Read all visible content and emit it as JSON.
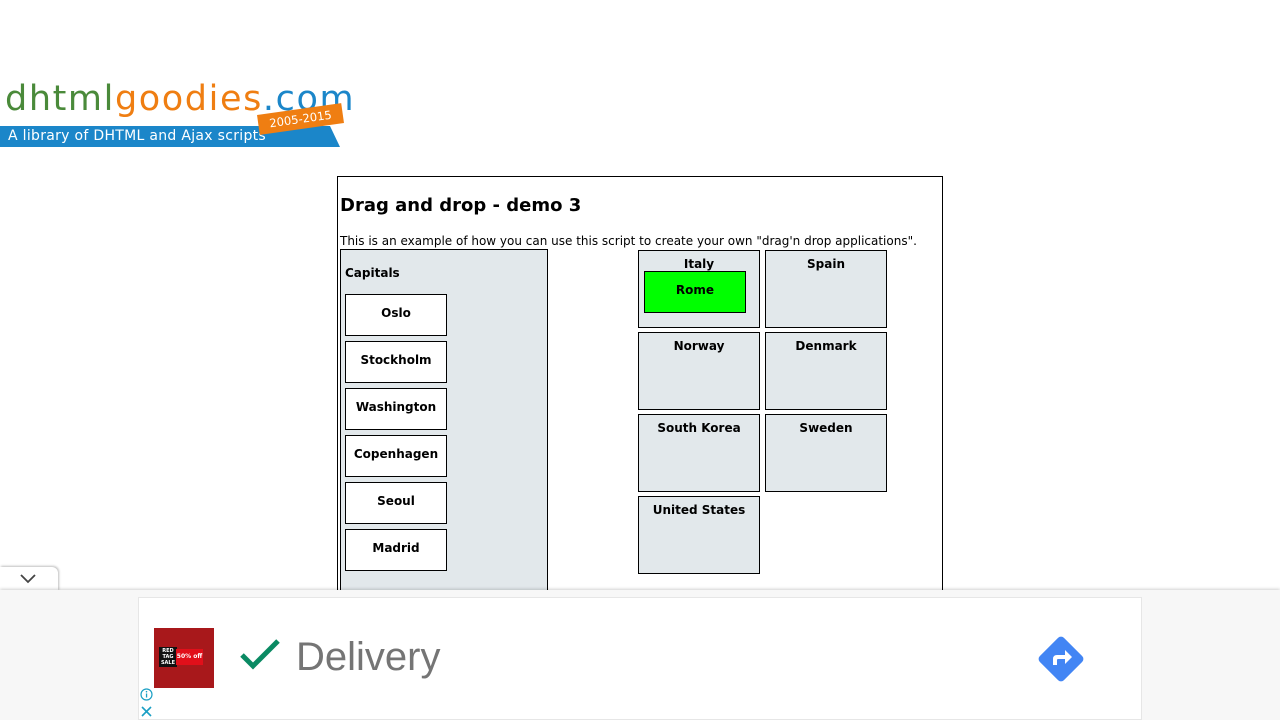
{
  "logo": {
    "parts": [
      "dhtml",
      "goodies",
      ".com"
    ],
    "tagline": "A library of DHTML and Ajax scripts",
    "years": "2005-2015",
    "colors": {
      "dhtml": "#4a8a3a",
      "goodies": "#ef7e12",
      "com": "#1b86c9",
      "band": "#1b86c9",
      "years_bg": "#ef7e12"
    }
  },
  "demo": {
    "title": "Drag and drop - demo 3",
    "description": "This is an example of how you can use this script to create your own \"drag'n drop applications\".",
    "capitals_title": "Capitals",
    "capitals": [
      "Oslo",
      "Stockholm",
      "Washington",
      "Copenhagen",
      "Seoul",
      "Madrid"
    ],
    "countries": [
      "Italy",
      "Spain",
      "Norway",
      "Denmark",
      "South Korea",
      "Sweden",
      "United States"
    ],
    "dropped": {
      "country": "Italy",
      "capital": "Rome",
      "color": "#00ff00"
    }
  },
  "ad": {
    "headline": "Delivery",
    "thumb_tag": "RED TAG SALE",
    "thumb_offer": "50% off",
    "check_color": "#0a8a63",
    "cta_color": "#4285f4"
  },
  "colors": {
    "panel_bg": "#e2e8eb"
  }
}
